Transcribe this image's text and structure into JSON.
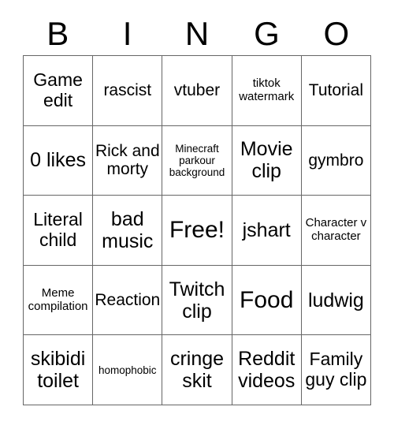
{
  "card": {
    "title_letters": [
      "B",
      "I",
      "N",
      "G",
      "O"
    ],
    "columns": 5,
    "rows": 5,
    "free_space_label": "Free!",
    "border_color": "#666666",
    "text_color": "#000000",
    "background_color": "#ffffff",
    "cells": [
      [
        {
          "label": "Game edit",
          "size": "lg"
        },
        {
          "label": "rascist",
          "size": "md"
        },
        {
          "label": "vtuber",
          "size": "md"
        },
        {
          "label": "tiktok watermark",
          "size": "sm"
        },
        {
          "label": "Tutorial",
          "size": "md"
        }
      ],
      [
        {
          "label": "0 likes",
          "size": "xl"
        },
        {
          "label": "Rick and morty",
          "size": "md"
        },
        {
          "label": "Minecraft parkour background",
          "size": "xs"
        },
        {
          "label": "Movie clip",
          "size": "xl"
        },
        {
          "label": "gymbro",
          "size": "md"
        }
      ],
      [
        {
          "label": "Literal child",
          "size": "lg"
        },
        {
          "label": "bad music",
          "size": "xl"
        },
        {
          "label": "Free!",
          "size": "xxl"
        },
        {
          "label": "jshart",
          "size": "xl"
        },
        {
          "label": "Character v character",
          "size": "sm"
        }
      ],
      [
        {
          "label": "Meme compilation",
          "size": "sm"
        },
        {
          "label": "Reaction",
          "size": "md"
        },
        {
          "label": "Twitch clip",
          "size": "xl"
        },
        {
          "label": "Food",
          "size": "xxl"
        },
        {
          "label": "ludwig",
          "size": "xl"
        }
      ],
      [
        {
          "label": "skibidi toilet",
          "size": "xl"
        },
        {
          "label": "homophobic",
          "size": "xs"
        },
        {
          "label": "cringe skit",
          "size": "xl"
        },
        {
          "label": "Reddit videos",
          "size": "xl"
        },
        {
          "label": "Family guy clip",
          "size": "lg"
        }
      ]
    ]
  }
}
